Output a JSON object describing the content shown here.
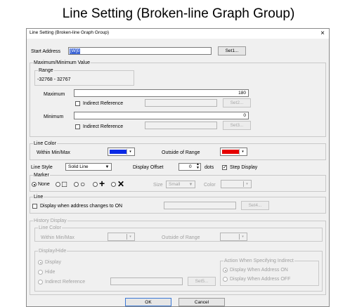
{
  "caption": "Line Setting (Broken-line Graph Group)",
  "dialog": {
    "title": "Line Setting (Broken-line Graph Group)",
    "close": "×",
    "start_address": {
      "label": "Start Address",
      "value": "[W]0",
      "button": "Set1..."
    },
    "maxmin": {
      "group": "Maximum/Minimum Value",
      "range_title": "Range",
      "range_value": "-32768 - 32767",
      "maximum_label": "Maximum",
      "maximum_value": "180",
      "indirect1": "Indirect Reference",
      "set2": "Set2...",
      "minimum_label": "Minimum",
      "minimum_value": "0",
      "indirect2": "Indirect Reference",
      "set3": "Set3..."
    },
    "line_color": {
      "group": "Line Color",
      "within": "Within Min/Max",
      "within_color": "#0a2ae6",
      "outside": "Outside of Range",
      "outside_color": "#e60000"
    },
    "style_row": {
      "line_style_label": "Line Style",
      "line_style_value": "Solid Line",
      "offset_label": "Display Offset",
      "offset_value": "0",
      "dots": "dots",
      "step_display": "Step Display"
    },
    "marker": {
      "group": "Marker",
      "none": "None",
      "square": "□",
      "circle": "○",
      "plus": "+",
      "cross": "✕",
      "size_label": "Size",
      "size_value": "Small",
      "color_label": "Color"
    },
    "line": {
      "group": "Line",
      "display_when": "Display when address changes to ON",
      "set4": "Set4..."
    },
    "history": {
      "group": "History Display",
      "line_color_group": "Line Color",
      "within": "Within Min/Max",
      "outside": "Outside of Range",
      "display_hide_group": "Display/Hide",
      "display": "Display",
      "hide": "Hide",
      "indirect": "Indirect Reference",
      "set5": "Set5...",
      "action_group": "Action When Specifying Indirect",
      "display_on": "Display When Address ON",
      "display_off": "Display When Address OFF"
    },
    "ok": "OK",
    "cancel": "Cancel"
  }
}
